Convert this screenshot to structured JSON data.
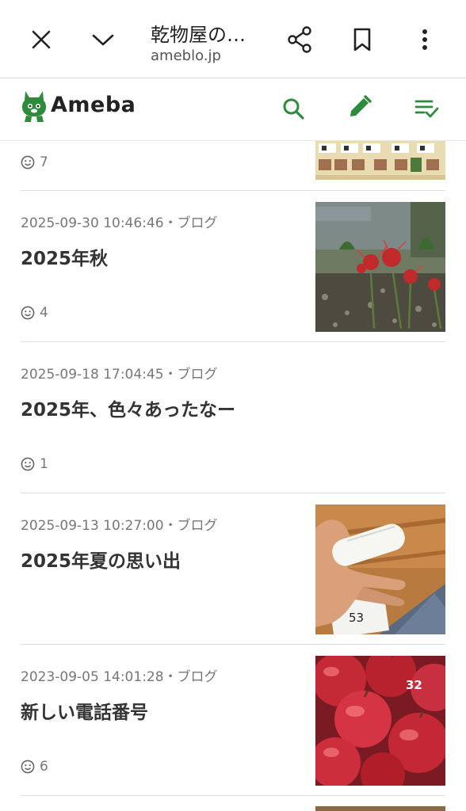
{
  "browser": {
    "title": "乾物屋の…",
    "url": "ameblo.jp"
  },
  "header": {
    "logo_text": "Ameba",
    "accent_color": "#2d8c3c"
  },
  "posts": [
    {
      "likes": "7"
    },
    {
      "date": "2025-09-30 10:46:46",
      "category": "・ブログ",
      "title": "2025年秋",
      "likes": "4",
      "thumb": "red-spider-lily"
    },
    {
      "date": "2025-09-18 17:04:45",
      "category": "・ブログ",
      "title": "2025年、色々あったなー",
      "likes": "1"
    },
    {
      "date": "2025-09-13 10:27:00",
      "category": "・ブログ",
      "title": "2025年夏の思い出",
      "likes": "",
      "thumb": "bandaged-hand"
    },
    {
      "date": "2023-09-05 14:01:28",
      "category": "・ブログ",
      "title": "新しい電話番号",
      "likes": "6",
      "thumb": "apples",
      "thumb_label": "32"
    }
  ],
  "thumb_misc": {
    "hand_number": "53"
  }
}
